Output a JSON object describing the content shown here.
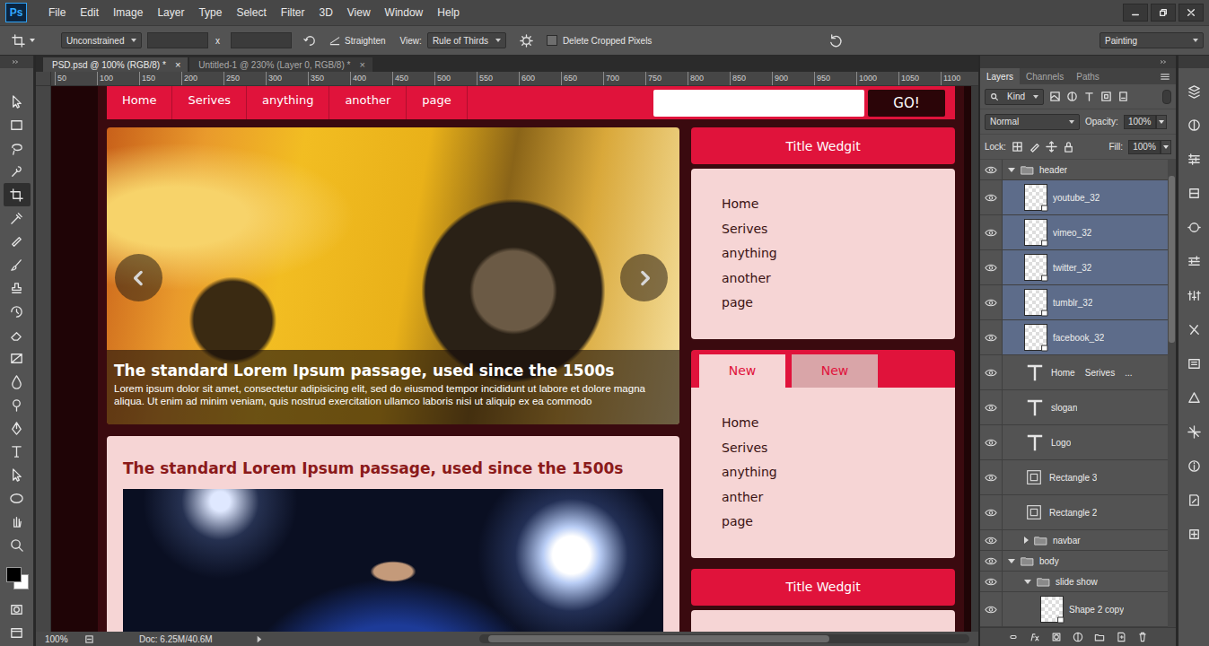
{
  "app_bar": {
    "logo": "Ps",
    "menu": [
      "File",
      "Edit",
      "Image",
      "Layer",
      "Type",
      "Select",
      "Filter",
      "3D",
      "View",
      "Window",
      "Help"
    ]
  },
  "options_bar": {
    "ratio": "Unconstrained",
    "times": "x",
    "straighten": "Straighten",
    "view_label": "View:",
    "view": "Rule of Thirds",
    "delete_cropped": {
      "label": "Delete Cropped Pixels",
      "checked": false
    },
    "workspace": "Painting"
  },
  "documents": [
    {
      "title": "PSD.psd @ 100% (RGB/8) *",
      "close": "×",
      "selected": true
    },
    {
      "title": "Untitled-1 @ 230% (Layer 0, RGB/8) *",
      "close": "×",
      "selected": false
    }
  ],
  "toolbar": {
    "tools": [
      {
        "selected": false
      },
      {
        "selected": false
      },
      {
        "selected": false
      },
      {
        "selected": false
      },
      {
        "selected": true
      },
      {
        "selected": false
      },
      {
        "selected": false
      },
      {
        "selected": false
      },
      {
        "selected": false
      },
      {
        "selected": false
      },
      {
        "selected": false
      },
      {
        "selected": false
      },
      {
        "selected": false
      },
      {
        "selected": false
      },
      {
        "selected": false
      },
      {
        "selected": false
      },
      {
        "selected": false
      },
      {
        "selected": false
      },
      {
        "selected": false
      },
      {
        "selected": false
      }
    ]
  },
  "ruler": {
    "marks": [
      "50",
      "100",
      "150",
      "200",
      "250",
      "300",
      "350",
      "400",
      "450",
      "500",
      "550",
      "600",
      "650",
      "700",
      "750",
      "800",
      "850",
      "900",
      "950",
      "1000",
      "1050",
      "1100"
    ]
  },
  "design": {
    "nav": [
      "Home",
      "Serives",
      "anything",
      "another",
      "page"
    ],
    "search_button": "GO!",
    "slider": {
      "title": "The standard Lorem Ipsum passage, used since the 1500s",
      "text": "Lorem ipsum dolor sit amet, consectetur adipisicing elit, sed do eiusmod tempor incididunt ut labore et dolore magna aliqua. Ut enim ad minim veniam, quis nostrud exercitation ullamco laboris nisi ut aliquip ex ea commodo"
    },
    "post": {
      "title": "The standard Lorem Ipsum passage, used since the 1500s"
    },
    "widgets": [
      {
        "kind": "titled",
        "title": "Title Wedgit",
        "items": [
          "Home",
          "Serives",
          "anything",
          "another",
          "page"
        ]
      },
      {
        "kind": "tabbed",
        "tabs": [
          {
            "label": "New",
            "selected": true
          },
          {
            "label": "New",
            "selected": false
          }
        ],
        "items": [
          "Home",
          "Serives",
          "anything",
          "anther",
          "page"
        ]
      },
      {
        "kind": "titled",
        "title": "Title Wedgit",
        "items": []
      }
    ]
  },
  "layers_panel": {
    "tabs": [
      {
        "label": "Layers",
        "selected": true
      },
      {
        "label": "Channels",
        "selected": false
      },
      {
        "label": "Paths",
        "selected": false
      }
    ],
    "filter": "Kind",
    "blend_mode": "Normal",
    "opacity_label": "Opacity:",
    "opacity": "100%",
    "lock_label": "Lock:",
    "fill_label": "Fill:",
    "fill": "100%",
    "layers": [
      {
        "name": "header",
        "kind": "folder",
        "depth": 0,
        "expanded": true,
        "selected": false,
        "visible": true
      },
      {
        "name": "youtube_32",
        "kind": "image",
        "depth": 1,
        "selected": true,
        "visible": true
      },
      {
        "name": "vimeo_32",
        "kind": "image",
        "depth": 1,
        "selected": true,
        "visible": true
      },
      {
        "name": "twitter_32",
        "kind": "image",
        "depth": 1,
        "selected": true,
        "visible": true
      },
      {
        "name": "tumblr_32",
        "kind": "image",
        "depth": 1,
        "selected": true,
        "visible": true
      },
      {
        "name": "facebook_32",
        "kind": "image",
        "depth": 1,
        "selected": true,
        "visible": true
      },
      {
        "name": "Home    Serives    ...",
        "kind": "text",
        "depth": 1,
        "selected": false,
        "visible": true
      },
      {
        "name": "slogan",
        "kind": "text",
        "depth": 1,
        "selected": false,
        "visible": true
      },
      {
        "name": "Logo",
        "kind": "text",
        "depth": 1,
        "selected": false,
        "visible": true
      },
      {
        "name": "Rectangle 3",
        "kind": "shape",
        "depth": 1,
        "selected": false,
        "visible": true
      },
      {
        "name": "Rectangle 2",
        "kind": "shape",
        "depth": 1,
        "selected": false,
        "visible": true
      },
      {
        "name": "navbar",
        "kind": "folder",
        "depth": 1,
        "expanded": false,
        "selected": false,
        "visible": true
      },
      {
        "name": "body",
        "kind": "folder",
        "depth": 0,
        "expanded": true,
        "selected": false,
        "visible": true
      },
      {
        "name": "slide show",
        "kind": "folder",
        "depth": 1,
        "expanded": true,
        "selected": false,
        "visible": true
      },
      {
        "name": "Shape 2 copy",
        "kind": "image",
        "depth": 2,
        "selected": false,
        "visible": true
      }
    ]
  },
  "status_bar": {
    "zoom": "100%",
    "doc": "Doc: 6.25M/40.6M"
  }
}
